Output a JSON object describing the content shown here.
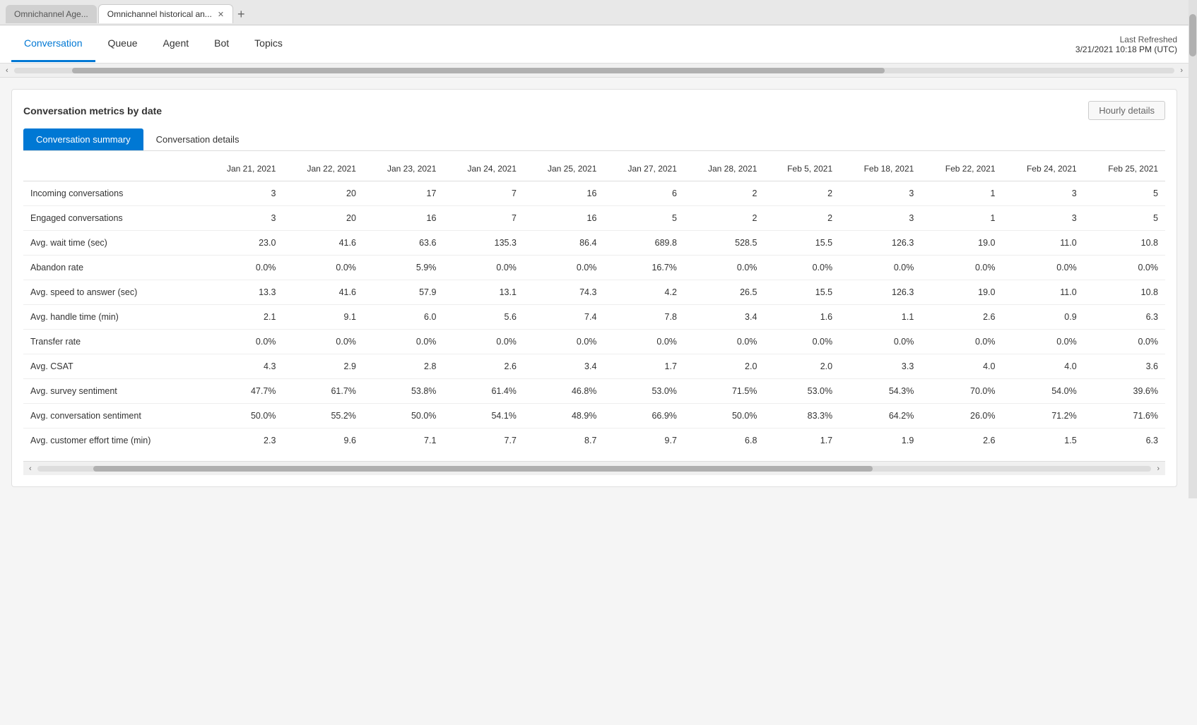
{
  "browser": {
    "tabs": [
      {
        "id": "tab1",
        "label": "Omnichannel Age...",
        "active": false
      },
      {
        "id": "tab2",
        "label": "Omnichannel historical an...",
        "active": true
      }
    ],
    "add_tab_label": "+"
  },
  "header": {
    "nav_tabs": [
      {
        "id": "conversation",
        "label": "Conversation",
        "active": true
      },
      {
        "id": "queue",
        "label": "Queue",
        "active": false
      },
      {
        "id": "agent",
        "label": "Agent",
        "active": false
      },
      {
        "id": "bot",
        "label": "Bot",
        "active": false
      },
      {
        "id": "topics",
        "label": "Topics",
        "active": false
      }
    ],
    "last_refreshed_label": "Last Refreshed",
    "last_refreshed_time": "3/21/2021 10:18 PM (UTC)"
  },
  "section": {
    "title": "Conversation metrics by date",
    "hourly_details_label": "Hourly details",
    "sub_tabs": [
      {
        "id": "summary",
        "label": "Conversation summary",
        "active": true
      },
      {
        "id": "details",
        "label": "Conversation details",
        "active": false
      }
    ]
  },
  "table": {
    "columns": [
      "",
      "Jan 21, 2021",
      "Jan 22, 2021",
      "Jan 23, 2021",
      "Jan 24, 2021",
      "Jan 25, 2021",
      "Jan 27, 2021",
      "Jan 28, 2021",
      "Feb 5, 2021",
      "Feb 18, 2021",
      "Feb 22, 2021",
      "Feb 24, 2021",
      "Feb 25, 2021"
    ],
    "rows": [
      {
        "label": "Incoming conversations",
        "values": [
          "3",
          "20",
          "17",
          "7",
          "16",
          "6",
          "2",
          "2",
          "3",
          "1",
          "3",
          "5"
        ]
      },
      {
        "label": "Engaged conversations",
        "values": [
          "3",
          "20",
          "16",
          "7",
          "16",
          "5",
          "2",
          "2",
          "3",
          "1",
          "3",
          "5"
        ]
      },
      {
        "label": "Avg. wait time (sec)",
        "values": [
          "23.0",
          "41.6",
          "63.6",
          "135.3",
          "86.4",
          "689.8",
          "528.5",
          "15.5",
          "126.3",
          "19.0",
          "11.0",
          "10.8"
        ]
      },
      {
        "label": "Abandon rate",
        "values": [
          "0.0%",
          "0.0%",
          "5.9%",
          "0.0%",
          "0.0%",
          "16.7%",
          "0.0%",
          "0.0%",
          "0.0%",
          "0.0%",
          "0.0%",
          "0.0%"
        ]
      },
      {
        "label": "Avg. speed to answer (sec)",
        "values": [
          "13.3",
          "41.6",
          "57.9",
          "13.1",
          "74.3",
          "4.2",
          "26.5",
          "15.5",
          "126.3",
          "19.0",
          "11.0",
          "10.8"
        ]
      },
      {
        "label": "Avg. handle time (min)",
        "values": [
          "2.1",
          "9.1",
          "6.0",
          "5.6",
          "7.4",
          "7.8",
          "3.4",
          "1.6",
          "1.1",
          "2.6",
          "0.9",
          "6.3"
        ]
      },
      {
        "label": "Transfer rate",
        "values": [
          "0.0%",
          "0.0%",
          "0.0%",
          "0.0%",
          "0.0%",
          "0.0%",
          "0.0%",
          "0.0%",
          "0.0%",
          "0.0%",
          "0.0%",
          "0.0%"
        ]
      },
      {
        "label": "Avg. CSAT",
        "values": [
          "4.3",
          "2.9",
          "2.8",
          "2.6",
          "3.4",
          "1.7",
          "2.0",
          "2.0",
          "3.3",
          "4.0",
          "4.0",
          "3.6"
        ]
      },
      {
        "label": "Avg. survey sentiment",
        "values": [
          "47.7%",
          "61.7%",
          "53.8%",
          "61.4%",
          "46.8%",
          "53.0%",
          "71.5%",
          "53.0%",
          "54.3%",
          "70.0%",
          "54.0%",
          "39.6%"
        ]
      },
      {
        "label": "Avg. conversation sentiment",
        "values": [
          "50.0%",
          "55.2%",
          "50.0%",
          "54.1%",
          "48.9%",
          "66.9%",
          "50.0%",
          "83.3%",
          "64.2%",
          "26.0%",
          "71.2%",
          "71.6%"
        ]
      },
      {
        "label": "Avg. customer effort time (min)",
        "values": [
          "2.3",
          "9.6",
          "7.1",
          "7.7",
          "8.7",
          "9.7",
          "6.8",
          "1.7",
          "1.9",
          "2.6",
          "1.5",
          "6.3"
        ]
      }
    ]
  }
}
